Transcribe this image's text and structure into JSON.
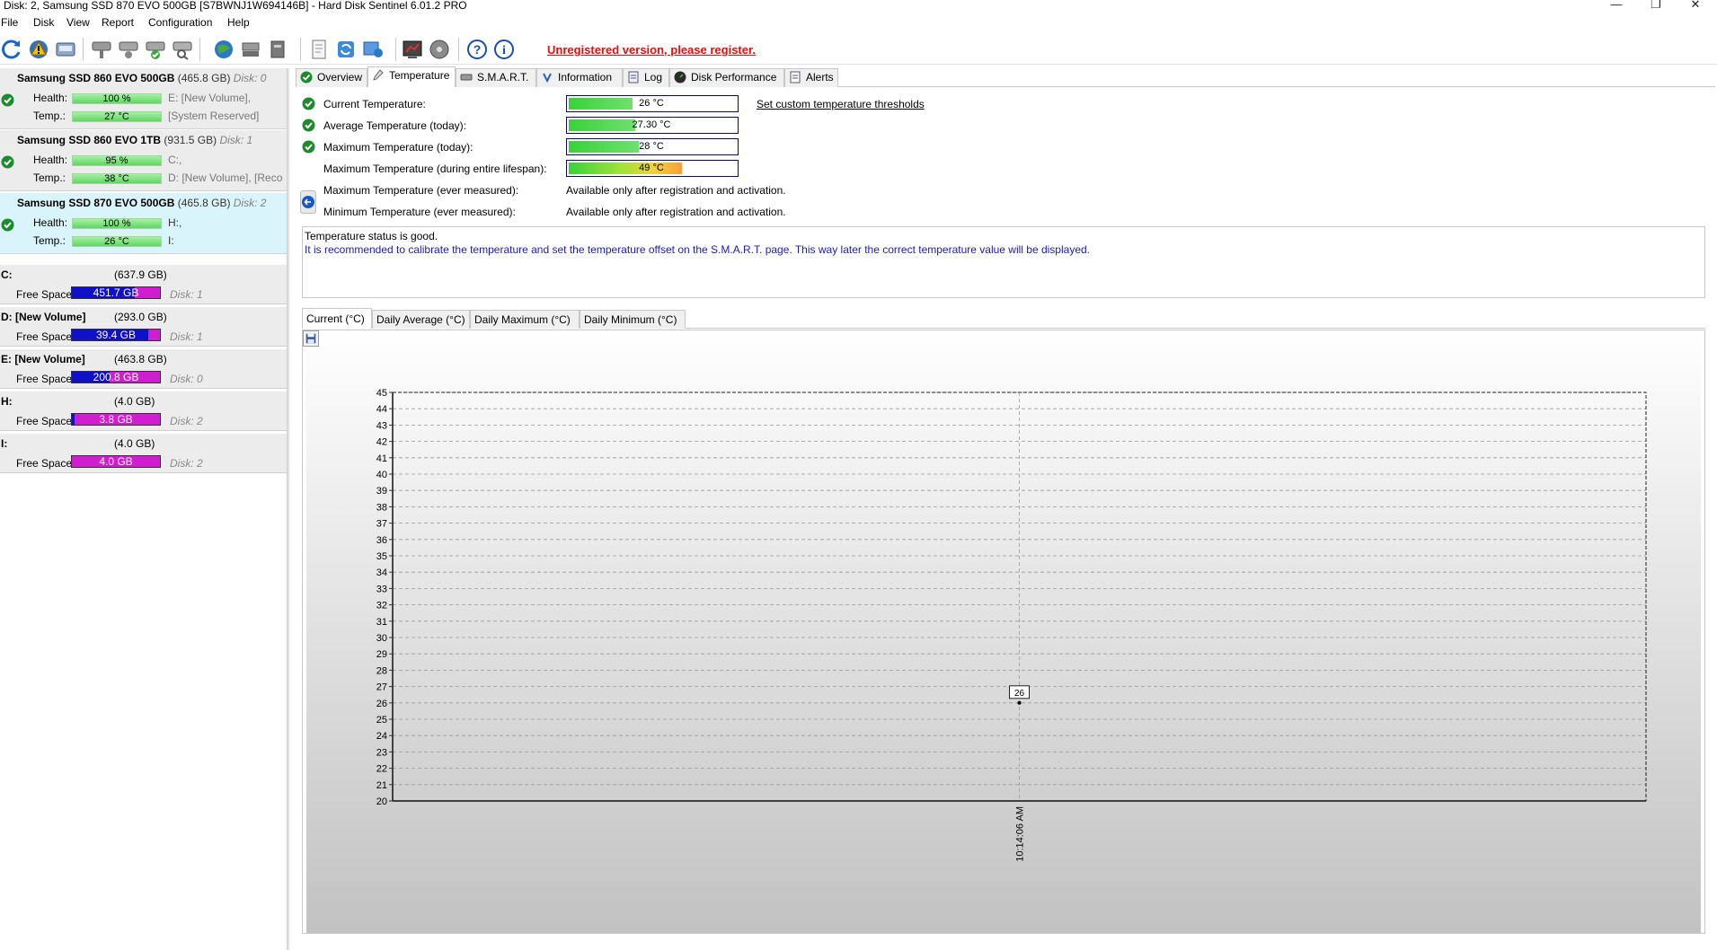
{
  "window": {
    "title": "Disk: 2, Samsung SSD 870 EVO 500GB [S7BWNJ1W694146B]  -  Hard Disk Sentinel 6.01.2 PRO",
    "minimize": "—",
    "maximize": "❐",
    "close": "✕"
  },
  "menu": [
    "File",
    "Disk",
    "View",
    "Report",
    "Configuration",
    "Help"
  ],
  "toolbar": {
    "register_text": "Unregistered version, please register."
  },
  "disks": [
    {
      "name": "Samsung SSD 860 EVO 500GB",
      "size": "(465.8 GB)",
      "disk": "Disk: 0",
      "health_label": "Health:",
      "health": "100 %",
      "health_pct": 100,
      "temp_label": "Temp.:",
      "temp": "27 °C",
      "vol1": "E: [New Volume],",
      "vol2": "[System Reserved]"
    },
    {
      "name": "Samsung SSD 860 EVO 1TB",
      "size": "(931.5 GB)",
      "disk": "Disk: 1",
      "health_label": "Health:",
      "health": "95 %",
      "health_pct": 95,
      "temp_label": "Temp.:",
      "temp": "38 °C",
      "vol1": "C:,",
      "vol2": "D: [New Volume],  [Reco"
    },
    {
      "name": "Samsung SSD 870 EVO 500GB",
      "size": "(465.8 GB)",
      "disk": "Disk: 2",
      "health_label": "Health:",
      "health": "100 %",
      "health_pct": 100,
      "temp_label": "Temp.:",
      "temp": "26 °C",
      "vol1": "H:,",
      "vol2": "I:"
    }
  ],
  "partitions": [
    {
      "name": "C:",
      "size": "(637.9 GB)",
      "free_label": "Free Space",
      "free": "451.7 GB",
      "free_pct": 71,
      "disk": "Disk: 1"
    },
    {
      "name": "D: [New Volume]",
      "size": "(293.0 GB)",
      "free_label": "Free Space",
      "free": "39.4 GB",
      "free_pct": 87,
      "disk": "Disk: 1"
    },
    {
      "name": "E: [New Volume]",
      "size": "(463.8 GB)",
      "free_label": "Free Space",
      "free": "200.8 GB",
      "free_pct": 43,
      "disk": "Disk: 0"
    },
    {
      "name": "H:",
      "size": "(4.0 GB)",
      "free_label": "Free Space",
      "free": "3.8 GB",
      "free_pct": 3,
      "disk": "Disk: 2"
    },
    {
      "name": "I:",
      "size": "(4.0 GB)",
      "free_label": "Free Space",
      "free": "4.0 GB",
      "free_pct": 0,
      "disk": "Disk: 2"
    }
  ],
  "tabs": [
    "Overview",
    "Temperature",
    "S.M.A.R.T.",
    "Information",
    "Log",
    "Disk Performance",
    "Alerts"
  ],
  "temperature": {
    "rows": [
      {
        "label": "Current Temperature:",
        "value": "26 °C",
        "level": 0.38,
        "warm": false
      },
      {
        "label": "Average Temperature (today):",
        "value": "27.30 °C",
        "level": 0.4,
        "warm": false
      },
      {
        "label": "Maximum Temperature (today):",
        "value": "28 °C",
        "level": 0.42,
        "warm": false
      },
      {
        "label": "Maximum Temperature (during entire lifespan):",
        "value": "49 °C",
        "level": 0.68,
        "warm": true
      }
    ],
    "unavailable": [
      {
        "label": "Maximum Temperature (ever measured):",
        "value": "Available only after registration and activation."
      },
      {
        "label": "Minimum Temperature (ever measured):",
        "value": "Available only after registration and activation."
      }
    ],
    "thresholds_link": "Set custom temperature thresholds",
    "status_line1": "Temperature status is good.",
    "status_line2": "It is recommended to calibrate the temperature and set the temperature offset on the S.M.A.R.T. page. This way later the correct temperature value will be displayed."
  },
  "subtabs": [
    "Current (°C)",
    "Daily Average (°C)",
    "Daily Maximum (°C)",
    "Daily Minimum (°C)"
  ],
  "chart_data": {
    "type": "line",
    "title": "",
    "xlabel": "",
    "ylabel": "",
    "ylim": [
      20,
      45
    ],
    "grid": true,
    "x": [
      "10:14:06 AM"
    ],
    "series": [
      {
        "values": [
          26
        ]
      }
    ],
    "data_labels": [
      "26"
    ]
  }
}
